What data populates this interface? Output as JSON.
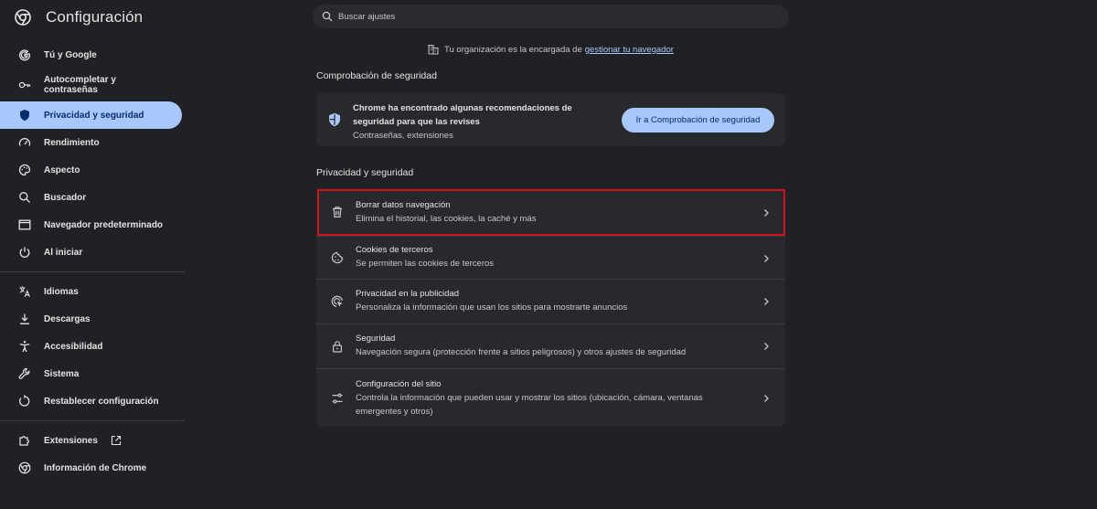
{
  "app": {
    "title": "Configuración",
    "logo_icon": "chrome-logo-icon"
  },
  "search": {
    "placeholder": "Buscar ajustes"
  },
  "sidebar": {
    "items": [
      {
        "label": "Tú y Google",
        "icon": "google-g-icon"
      },
      {
        "label": "Autocompletar y contraseñas",
        "icon": "key-icon"
      },
      {
        "label": "Privacidad y seguridad",
        "icon": "shield-icon",
        "active": true
      },
      {
        "label": "Rendimiento",
        "icon": "speedometer-icon"
      },
      {
        "label": "Aspecto",
        "icon": "palette-icon"
      },
      {
        "label": "Buscador",
        "icon": "search-icon"
      },
      {
        "label": "Navegador predeterminado",
        "icon": "browser-window-icon"
      },
      {
        "label": "Al iniciar",
        "icon": "power-icon"
      },
      {
        "label": "Idiomas",
        "icon": "translate-icon"
      },
      {
        "label": "Descargas",
        "icon": "download-icon"
      },
      {
        "label": "Accesibilidad",
        "icon": "accessibility-icon"
      },
      {
        "label": "Sistema",
        "icon": "wrench-icon"
      },
      {
        "label": "Restablecer configuración",
        "icon": "reset-icon"
      },
      {
        "label": "Extensiones",
        "icon": "puzzle-icon",
        "external_icon": "open-external-icon"
      },
      {
        "label": "Información de Chrome",
        "icon": "chrome-info-icon"
      }
    ]
  },
  "org_notice": {
    "text": "Tu organización es la encargada de",
    "link": "gestionar tu navegador",
    "icon": "building-icon"
  },
  "safety_check": {
    "section_title": "Comprobación de seguridad",
    "line1": "Chrome ha encontrado algunas recomendaciones de",
    "line2": "seguridad para que las revises",
    "subtitle": "Contraseñas, extensiones",
    "button": "Ir a Comprobación de seguridad",
    "icon": "shield-check-icon"
  },
  "privacy": {
    "section_title": "Privacidad y seguridad",
    "rows": [
      {
        "title": "Borrar datos navegación",
        "subtitle": "Elimina el historial, las cookies, la caché y más",
        "icon": "trash-icon"
      },
      {
        "title": "Cookies de terceros",
        "subtitle": "Se permiten las cookies de terceros",
        "icon": "cookie-icon"
      },
      {
        "title": "Privacidad en la publicidad",
        "subtitle": "Personaliza la información que usan los sitios para mostrarte anuncios",
        "icon": "ads-target-icon"
      },
      {
        "title": "Seguridad",
        "subtitle": "Navegación segura (protección frente a sitios peligrosos) y otros ajustes de seguridad",
        "icon": "lock-icon"
      },
      {
        "title": "Configuración del sitio",
        "subtitle": "Controla la información que pueden usar y mostrar los sitios (ubicación, cámara, ventanas",
        "subtitle2": "emergentes y otros)",
        "icon": "tune-icon"
      }
    ]
  },
  "colors": {
    "background": "#202124",
    "card": "#28292c",
    "accent": "#a8c7fa",
    "highlight": "#d0121b"
  }
}
